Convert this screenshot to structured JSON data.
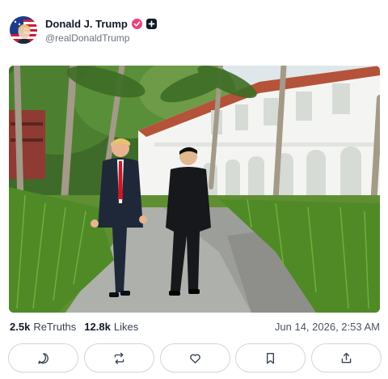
{
  "post": {
    "display_name": "Donald J. Trump",
    "handle": "@realDonaldTrump",
    "badge_icon": "verified-badge-icon",
    "badge_color": "#e9427e",
    "extra_icon": "plus-icon",
    "avatar_icon": "flag-portrait-avatar",
    "image_description_icon": "photo-two-men-walking"
  },
  "stats": {
    "retruths_count": "2.5k",
    "retruths_label": "ReTruths",
    "likes_count": "12.8k",
    "likes_label": "Likes",
    "timestamp": "Jun 14, 2026, 2:53 AM"
  },
  "actions": [
    {
      "icon": "reply-icon"
    },
    {
      "icon": "retruth-icon"
    },
    {
      "icon": "like-heart-icon"
    },
    {
      "icon": "bookmark-icon"
    },
    {
      "icon": "share-icon"
    }
  ]
}
